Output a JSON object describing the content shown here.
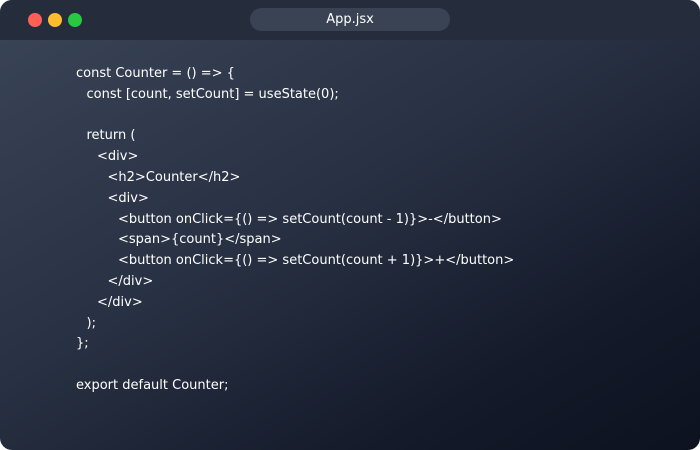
{
  "window": {
    "tab_title": "App.jsx",
    "controls": {
      "close_color": "#ff5f57",
      "minimize_color": "#febc2e",
      "maximize_color": "#28c840"
    }
  },
  "editor": {
    "text_color": "#ffffff",
    "lines": [
      {
        "indent": 0,
        "text": "const Counter = () => {"
      },
      {
        "indent": 1,
        "text": "const [count, setCount] = useState(0);"
      },
      {
        "indent": 0,
        "text": ""
      },
      {
        "indent": 1,
        "text": "return ("
      },
      {
        "indent": 2,
        "text": "<div>"
      },
      {
        "indent": 3,
        "text": "<h2>Counter</h2>"
      },
      {
        "indent": 3,
        "text": "<div>"
      },
      {
        "indent": 4,
        "text": "<button onClick={() => setCount(count - 1)}>-</button>"
      },
      {
        "indent": 4,
        "text": "<span>{count}</span>"
      },
      {
        "indent": 4,
        "text": "<button onClick={() => setCount(count + 1)}>+</button>"
      },
      {
        "indent": 3,
        "text": "</div>"
      },
      {
        "indent": 2,
        "text": "</div>"
      },
      {
        "indent": 1,
        "text": ");"
      },
      {
        "indent": 0,
        "text": "};"
      },
      {
        "indent": 0,
        "text": ""
      },
      {
        "indent": 0,
        "text": "export default Counter;"
      }
    ]
  }
}
